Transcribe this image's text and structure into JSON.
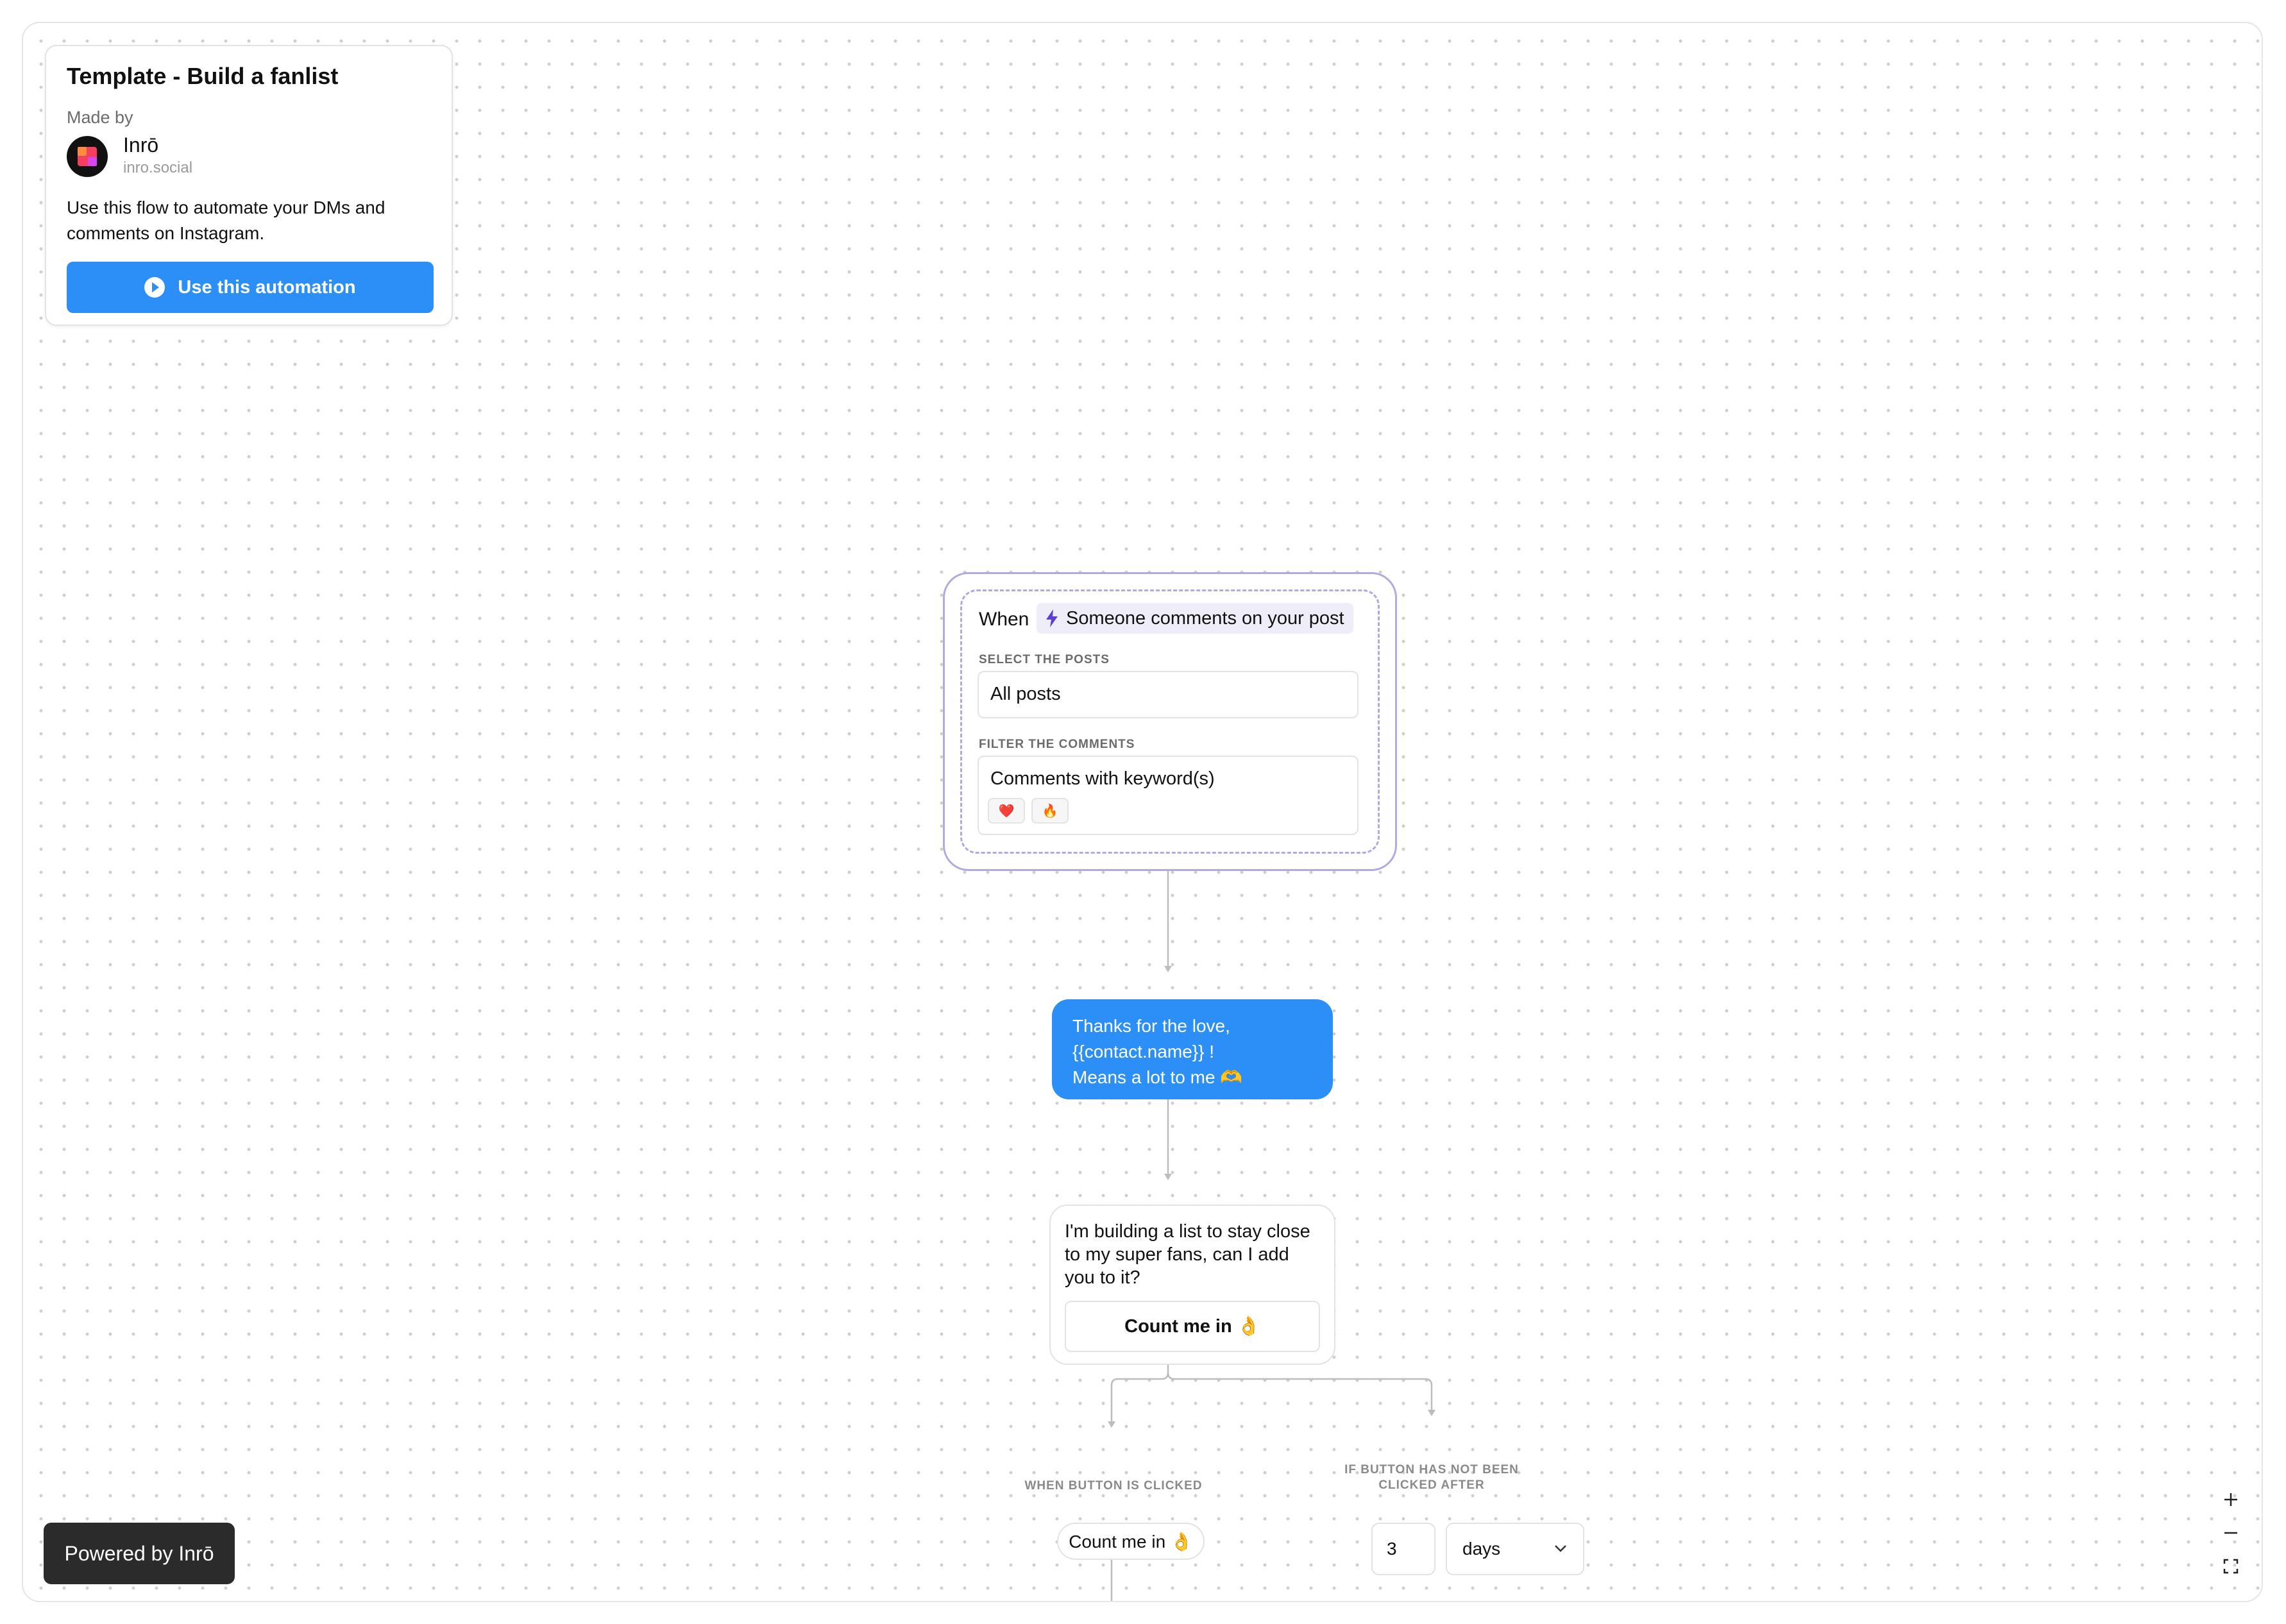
{
  "info_card": {
    "title": "Template - Build a fanlist",
    "made_by_label": "Made by",
    "author_name": "Inrō",
    "author_url": "inro.social",
    "description": "Use this flow to automate your DMs and comments on Instagram.",
    "cta_label": "Use this automation"
  },
  "trigger": {
    "when_label": "When",
    "event_label": "Someone comments on your post",
    "select_posts_heading": "SELECT THE POSTS",
    "select_posts_value": "All posts",
    "filter_heading": "FILTER THE COMMENTS",
    "filter_value": "Comments with keyword(s)",
    "keywords": [
      "❤️",
      "🔥"
    ]
  },
  "message_1": {
    "line1": "Thanks for the love,",
    "line2": "{{contact.name}} !",
    "line3": "Means a lot to me 🫶"
  },
  "message_2": {
    "text": "I'm building a list to stay close to my super fans, can I add you to it?",
    "button_label": "Count me in 👌"
  },
  "branches": {
    "clicked_label": "WHEN BUTTON IS CLICKED",
    "clicked_button": "Count me in 👌",
    "not_clicked_label": "IF BUTTON HAS NOT BEEN CLICKED AFTER",
    "delay_value": "3",
    "delay_unit": "days"
  },
  "footer": {
    "powered_by": "Powered by Inrō"
  },
  "colors": {
    "accent_blue": "#2b8ff7",
    "trigger_border": "#b5a7e2",
    "bolt": "#5b3fd6"
  }
}
